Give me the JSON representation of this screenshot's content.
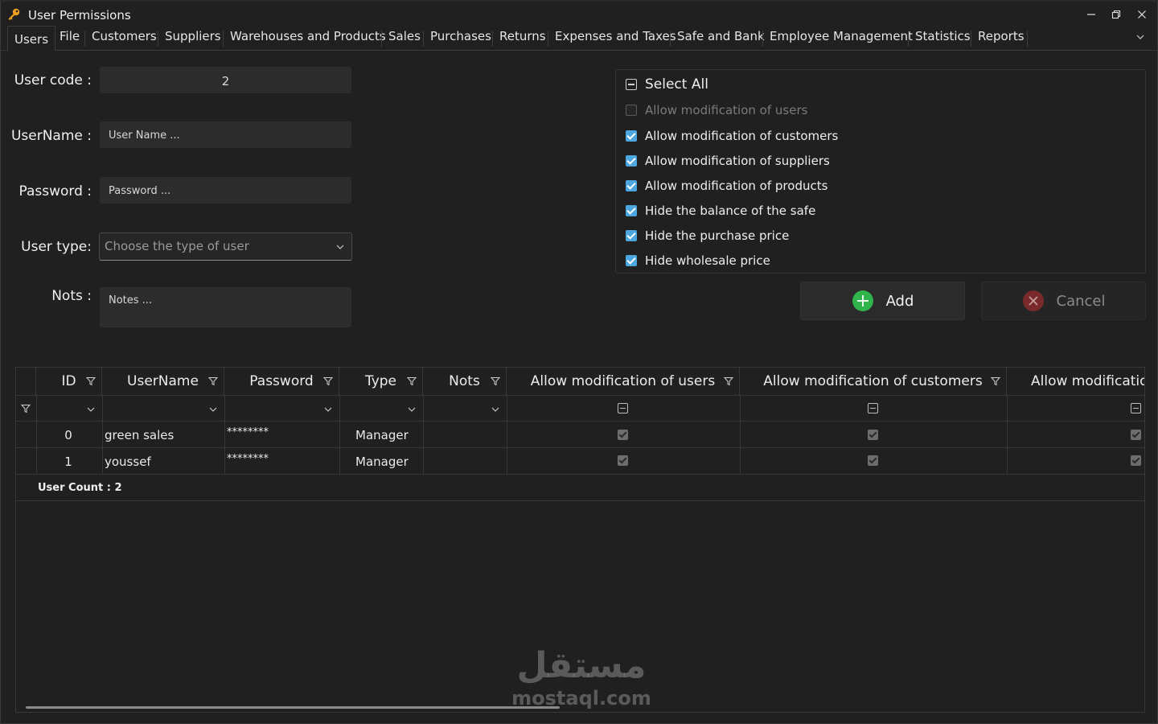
{
  "window": {
    "title": "User Permissions",
    "controls": {
      "minimize": "—",
      "restore": "❐",
      "close": "✕"
    }
  },
  "menu": {
    "items": [
      "Users",
      "File",
      "Customers",
      "Suppliers",
      "Warehouses and Products",
      "Sales",
      "Purchases",
      "Returns",
      "Expenses and Taxes",
      "Safe and Bank",
      "Employee Management",
      "Statistics",
      "Reports"
    ],
    "active": "Users"
  },
  "form": {
    "user_code_label": "User code :",
    "user_code_value": "2",
    "username_label": "UserName :",
    "username_placeholder": "User Name ...",
    "password_label": "Password :",
    "password_placeholder": "Password ...",
    "user_type_label": "User type:",
    "user_type_placeholder": "Choose the type of user",
    "notes_label": "Nots :",
    "notes_placeholder": "Notes ..."
  },
  "permissions": {
    "select_all": {
      "label": "Select All",
      "state": "indeterminate"
    },
    "items": [
      {
        "label": "Allow modification of users",
        "checked": false,
        "enabled": false
      },
      {
        "label": "Allow modification of customers",
        "checked": true,
        "enabled": true
      },
      {
        "label": "Allow modification of suppliers",
        "checked": true,
        "enabled": true
      },
      {
        "label": "Allow modification of products",
        "checked": true,
        "enabled": true
      },
      {
        "label": "Hide the balance of the safe",
        "checked": true,
        "enabled": true
      },
      {
        "label": "Hide the purchase price",
        "checked": true,
        "enabled": true
      },
      {
        "label": "Hide wholesale price",
        "checked": true,
        "enabled": true
      }
    ]
  },
  "buttons": {
    "add": "Add",
    "cancel": "Cancel"
  },
  "grid": {
    "columns": [
      "ID",
      "UserName",
      "Password",
      "Type",
      "Nots",
      "Allow modification of users",
      "Allow modification of customers",
      "Allow modificatio"
    ],
    "rows": [
      {
        "id": "0",
        "username": "green sales",
        "password": "********",
        "type": "Manager",
        "nots": "",
        "perm_users": true,
        "perm_customers": true,
        "perm_more": true
      },
      {
        "id": "1",
        "username": "youssef",
        "password": "********",
        "type": "Manager",
        "nots": "",
        "perm_users": true,
        "perm_customers": true,
        "perm_more": true
      }
    ],
    "footer": "User Count : 2"
  },
  "watermark": {
    "arabic": "مستقل",
    "latin": "mostaql.com"
  },
  "colors": {
    "accent": "#4ca6e0",
    "add_icon": "#2fb34a",
    "cancel_icon": "#c0392b",
    "background": "#202020"
  }
}
